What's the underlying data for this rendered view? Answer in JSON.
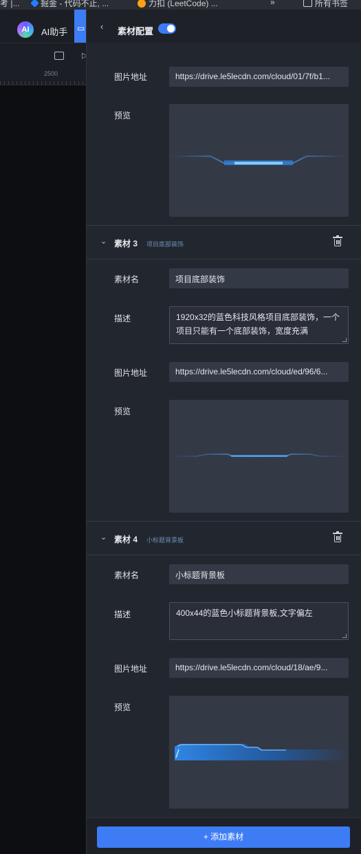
{
  "bookmarks": {
    "items": [
      {
        "label": "考 |..."
      },
      {
        "label": "掘金 - 代码不止, ..."
      },
      {
        "label": "力扣 (LeetCode) ..."
      },
      {
        "label": "»"
      },
      {
        "label": "所有书签"
      }
    ]
  },
  "app": {
    "ai_label": "AI助手",
    "ai_logo_text": "AI",
    "ruler_value": "2500"
  },
  "panel": {
    "title": "素材配置",
    "toggle_on": true,
    "item2": {
      "image_label": "图片地址",
      "image_url": "https://drive.le5lecdn.com/cloud/01/7f/b1...",
      "preview_label": "预览"
    },
    "item3": {
      "title": "素材 3",
      "subtitle": "项目底部装饰",
      "name_label": "素材名",
      "name_value": "项目底部装饰",
      "desc_label": "描述",
      "desc_value": "1920x32的蓝色科技风格项目底部装饰，一个项目只能有一个底部装饰，宽度充满",
      "image_label": "图片地址",
      "image_url": "https://drive.le5lecdn.com/cloud/ed/96/6...",
      "preview_label": "预览"
    },
    "item4": {
      "title": "素材 4",
      "subtitle": "小标题背景板",
      "name_label": "素材名",
      "name_value": "小标题背景板",
      "desc_label": "描述",
      "desc_value": "400x44的蓝色小标题背景板,文字偏左",
      "image_label": "图片地址",
      "image_url": "https://drive.le5lecdn.com/cloud/18/ae/9...",
      "preview_label": "预览"
    },
    "add_button": "+ 添加素材"
  },
  "colors": {
    "accent": "#3d7cf5",
    "panel_bg": "#22262e",
    "field_bg": "#343946"
  }
}
